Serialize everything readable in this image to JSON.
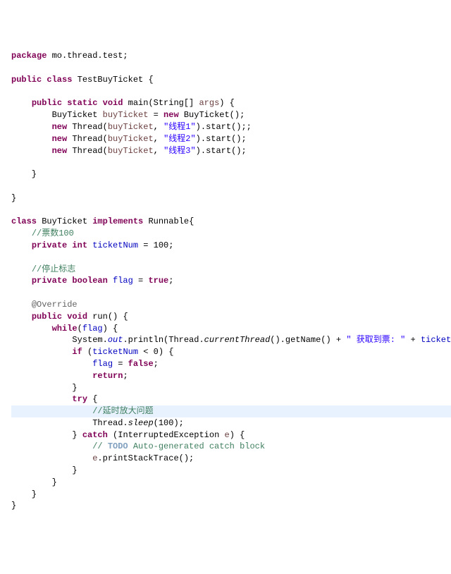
{
  "lines": [
    {
      "indent": 0,
      "segs": [
        {
          "t": "package ",
          "c": "kw"
        },
        {
          "t": "mo.thread.test;",
          "c": "pkg"
        }
      ]
    },
    {
      "indent": 0,
      "segs": [
        {
          "t": "",
          "c": ""
        }
      ]
    },
    {
      "indent": 0,
      "segs": [
        {
          "t": "public class ",
          "c": "kw"
        },
        {
          "t": "TestBuyTicket {",
          "c": ""
        }
      ]
    },
    {
      "indent": 0,
      "segs": [
        {
          "t": "",
          "c": ""
        }
      ]
    },
    {
      "indent": 1,
      "segs": [
        {
          "t": "public static void ",
          "c": "kw"
        },
        {
          "t": "main(String[] ",
          "c": ""
        },
        {
          "t": "args",
          "c": "param"
        },
        {
          "t": ") {",
          "c": ""
        }
      ]
    },
    {
      "indent": 2,
      "segs": [
        {
          "t": "BuyTicket ",
          "c": ""
        },
        {
          "t": "buyTicket",
          "c": "param"
        },
        {
          "t": " = ",
          "c": ""
        },
        {
          "t": "new ",
          "c": "kw"
        },
        {
          "t": "BuyTicket();",
          "c": ""
        }
      ]
    },
    {
      "indent": 2,
      "segs": [
        {
          "t": "new ",
          "c": "kw"
        },
        {
          "t": "Thread(",
          "c": ""
        },
        {
          "t": "buyTicket",
          "c": "param"
        },
        {
          "t": ", ",
          "c": ""
        },
        {
          "t": "\"线程1\"",
          "c": "str"
        },
        {
          "t": ").start();;",
          "c": ""
        }
      ]
    },
    {
      "indent": 2,
      "segs": [
        {
          "t": "new ",
          "c": "kw"
        },
        {
          "t": "Thread(",
          "c": ""
        },
        {
          "t": "buyTicket",
          "c": "param"
        },
        {
          "t": ", ",
          "c": ""
        },
        {
          "t": "\"线程2\"",
          "c": "str"
        },
        {
          "t": ").start();",
          "c": ""
        }
      ]
    },
    {
      "indent": 2,
      "segs": [
        {
          "t": "new ",
          "c": "kw"
        },
        {
          "t": "Thread(",
          "c": ""
        },
        {
          "t": "buyTicket",
          "c": "param"
        },
        {
          "t": ", ",
          "c": ""
        },
        {
          "t": "\"线程3\"",
          "c": "str"
        },
        {
          "t": ").start();",
          "c": ""
        }
      ]
    },
    {
      "indent": 0,
      "segs": [
        {
          "t": "",
          "c": ""
        }
      ]
    },
    {
      "indent": 1,
      "segs": [
        {
          "t": "}",
          "c": ""
        }
      ]
    },
    {
      "indent": 0,
      "segs": [
        {
          "t": "",
          "c": ""
        }
      ]
    },
    {
      "indent": 0,
      "segs": [
        {
          "t": "}",
          "c": ""
        }
      ]
    },
    {
      "indent": 0,
      "segs": [
        {
          "t": "",
          "c": ""
        }
      ]
    },
    {
      "indent": 0,
      "segs": [
        {
          "t": "class ",
          "c": "kw"
        },
        {
          "t": "BuyTicket ",
          "c": ""
        },
        {
          "t": "implements ",
          "c": "kw"
        },
        {
          "t": "Runnable{",
          "c": ""
        }
      ]
    },
    {
      "indent": 1,
      "segs": [
        {
          "t": "//票数100",
          "c": "comment"
        }
      ]
    },
    {
      "indent": 1,
      "segs": [
        {
          "t": "private int ",
          "c": "kw"
        },
        {
          "t": "ticketNum",
          "c": "field"
        },
        {
          "t": " = 100;",
          "c": ""
        }
      ]
    },
    {
      "indent": 0,
      "segs": [
        {
          "t": "",
          "c": ""
        }
      ]
    },
    {
      "indent": 1,
      "segs": [
        {
          "t": "//停止标志",
          "c": "comment"
        }
      ]
    },
    {
      "indent": 1,
      "segs": [
        {
          "t": "private boolean ",
          "c": "kw"
        },
        {
          "t": "flag",
          "c": "field"
        },
        {
          "t": " = ",
          "c": ""
        },
        {
          "t": "true",
          "c": "kw"
        },
        {
          "t": ";",
          "c": ""
        }
      ]
    },
    {
      "indent": 0,
      "segs": [
        {
          "t": "",
          "c": ""
        }
      ]
    },
    {
      "indent": 1,
      "segs": [
        {
          "t": "@Override",
          "c": "ann"
        }
      ]
    },
    {
      "indent": 1,
      "segs": [
        {
          "t": "public void ",
          "c": "kw"
        },
        {
          "t": "run() {",
          "c": ""
        }
      ]
    },
    {
      "indent": 2,
      "segs": [
        {
          "t": "while",
          "c": "kw"
        },
        {
          "t": "(",
          "c": ""
        },
        {
          "t": "flag",
          "c": "field"
        },
        {
          "t": ") {",
          "c": ""
        }
      ]
    },
    {
      "indent": 3,
      "segs": [
        {
          "t": "System.",
          "c": ""
        },
        {
          "t": "out",
          "c": "static-field"
        },
        {
          "t": ".println(Thread.",
          "c": ""
        },
        {
          "t": "currentThread",
          "c": "static-method"
        },
        {
          "t": "().getName() + ",
          "c": ""
        },
        {
          "t": "\" 获取到票: \"",
          "c": "str"
        },
        {
          "t": " + ",
          "c": ""
        },
        {
          "t": "ticketNum",
          "c": "field"
        },
        {
          "t": "--);",
          "c": ""
        }
      ]
    },
    {
      "indent": 3,
      "segs": [
        {
          "t": "if ",
          "c": "kw"
        },
        {
          "t": "(",
          "c": ""
        },
        {
          "t": "ticketNum",
          "c": "field"
        },
        {
          "t": " < 0) {",
          "c": ""
        }
      ]
    },
    {
      "indent": 4,
      "segs": [
        {
          "t": "flag",
          "c": "field"
        },
        {
          "t": " = ",
          "c": ""
        },
        {
          "t": "false",
          "c": "kw"
        },
        {
          "t": ";",
          "c": ""
        }
      ]
    },
    {
      "indent": 4,
      "segs": [
        {
          "t": "return",
          "c": "kw"
        },
        {
          "t": ";",
          "c": ""
        }
      ]
    },
    {
      "indent": 3,
      "segs": [
        {
          "t": "}",
          "c": ""
        }
      ]
    },
    {
      "indent": 3,
      "segs": [
        {
          "t": "try ",
          "c": "kw"
        },
        {
          "t": "{",
          "c": ""
        }
      ]
    },
    {
      "indent": 4,
      "segs": [
        {
          "t": "//延时放大问题",
          "c": "comment"
        }
      ],
      "hl": true
    },
    {
      "indent": 4,
      "segs": [
        {
          "t": "Thread.",
          "c": ""
        },
        {
          "t": "sleep",
          "c": "static-method"
        },
        {
          "t": "(100);",
          "c": ""
        }
      ]
    },
    {
      "indent": 3,
      "segs": [
        {
          "t": "} ",
          "c": ""
        },
        {
          "t": "catch ",
          "c": "kw"
        },
        {
          "t": "(InterruptedException ",
          "c": ""
        },
        {
          "t": "e",
          "c": "param"
        },
        {
          "t": ") {",
          "c": ""
        }
      ]
    },
    {
      "indent": 4,
      "segs": [
        {
          "t": "// ",
          "c": "comment"
        },
        {
          "t": "TODO",
          "c": "todo"
        },
        {
          "t": " Auto-generated catch block",
          "c": "comment"
        }
      ]
    },
    {
      "indent": 4,
      "segs": [
        {
          "t": "e",
          "c": "param"
        },
        {
          "t": ".printStackTrace();",
          "c": ""
        }
      ]
    },
    {
      "indent": 3,
      "segs": [
        {
          "t": "}",
          "c": ""
        }
      ]
    },
    {
      "indent": 2,
      "segs": [
        {
          "t": "}",
          "c": ""
        }
      ]
    },
    {
      "indent": 1,
      "segs": [
        {
          "t": "}",
          "c": ""
        }
      ]
    },
    {
      "indent": 0,
      "segs": [
        {
          "t": "}",
          "c": ""
        }
      ]
    }
  ]
}
